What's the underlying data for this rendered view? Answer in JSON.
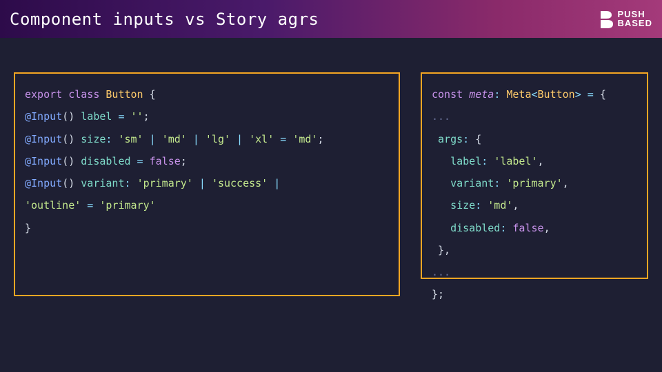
{
  "header": {
    "title": "Component inputs vs Story agrs",
    "logo_top": "PUSH",
    "logo_bottom": "BASED"
  },
  "left": {
    "l1_export": "export",
    "l1_class": "class",
    "l1_name": "Button",
    "l1_brace": " {",
    "dec": "@Input",
    "l2_prop": "label",
    "l2_eq": " = ",
    "l2_val": "''",
    "l2_semi": ";",
    "l3_prop": "size",
    "l3_colon": ": ",
    "l3_sm": "'sm'",
    "l3_md": "'md'",
    "l3_lg": "'lg'",
    "l3_xl": "'xl'",
    "pipe": " | ",
    "eq": " = ",
    "semi": ";",
    "l4_prop": "disabled",
    "l4_val": "false",
    "l5_prop": "variant",
    "l5_primary": "'primary'",
    "l5_success": "'success'",
    "l6_outline": "'outline'",
    "close": "}"
  },
  "right": {
    "const": "const",
    "meta": "meta",
    "metaType": "Meta",
    "btn": "Button",
    "dots": "...",
    "args": "args",
    "label_k": "label",
    "label_v": "'label'",
    "variant_k": "variant",
    "variant_v": "'primary'",
    "size_k": "size",
    "size_v": "'md'",
    "disabled_k": "disabled",
    "disabled_v": "false",
    "closeObj": "};"
  }
}
